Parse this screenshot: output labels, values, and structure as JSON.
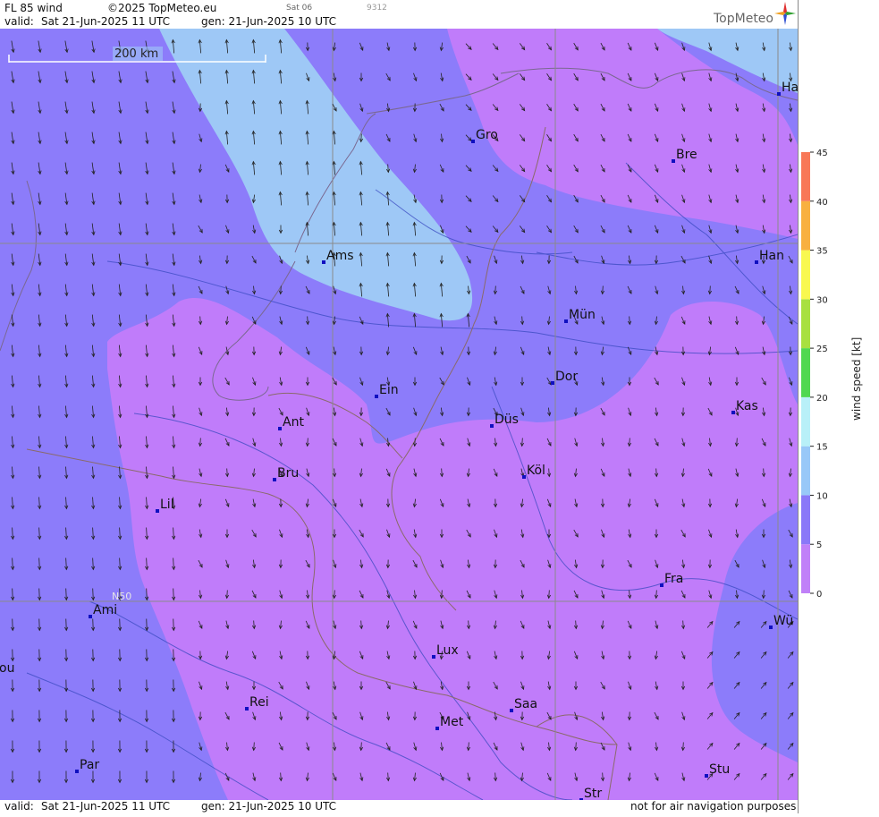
{
  "header": {
    "product": "FL 85 wind",
    "copyright": "©2025 TopMeteo.eu",
    "sat": "Sat 06",
    "code": "9312",
    "valid_label": "valid:",
    "valid_time": "Sat  21-Jun-2025  11 UTC",
    "gen_time": "gen: 21-Jun-2025 10 UTC",
    "brand": "TopMeteo"
  },
  "footer": {
    "valid_label": "valid:",
    "valid_time": "Sat  21-Jun-2025  11 UTC",
    "gen_time": "gen: 21-Jun-2025 10 UTC",
    "disclaimer": "not for air navigation purposes"
  },
  "map": {
    "scale_label": "200 km",
    "lat_label": "N50",
    "cities": [
      {
        "label": "Gro"
      },
      {
        "label": "Bre"
      },
      {
        "label": "Ha"
      },
      {
        "label": "Han"
      },
      {
        "label": "Ams"
      },
      {
        "label": "Mün"
      },
      {
        "label": "Dor"
      },
      {
        "label": "Ein"
      },
      {
        "label": "Kas"
      },
      {
        "label": "Düs"
      },
      {
        "label": "Ant"
      },
      {
        "label": "Köl"
      },
      {
        "label": "Bru"
      },
      {
        "label": "Lil"
      },
      {
        "label": "Fra"
      },
      {
        "label": "Ami"
      },
      {
        "label": "Wü"
      },
      {
        "label": "Lux"
      },
      {
        "label": "ou"
      },
      {
        "label": "Rei"
      },
      {
        "label": "Saa"
      },
      {
        "label": "Met"
      },
      {
        "label": "Stu"
      },
      {
        "label": "Par"
      },
      {
        "label": "Str"
      }
    ]
  },
  "colorbar": {
    "title": "wind speed  [kt]",
    "ticks": [
      "0",
      "5",
      "10",
      "15",
      "20",
      "25",
      "30",
      "35",
      "40",
      "45"
    ],
    "colors": [
      "#c080f8",
      "#8a78f8",
      "#98c8f8",
      "#b8f0f8",
      "#50d850",
      "#a8e040",
      "#f8f850",
      "#f8b040",
      "#f87858"
    ]
  },
  "wind_colors": {
    "lt5": "#c07cfa",
    "5to10": "#8c7cfa",
    "10to15": "#9ec8f6"
  }
}
